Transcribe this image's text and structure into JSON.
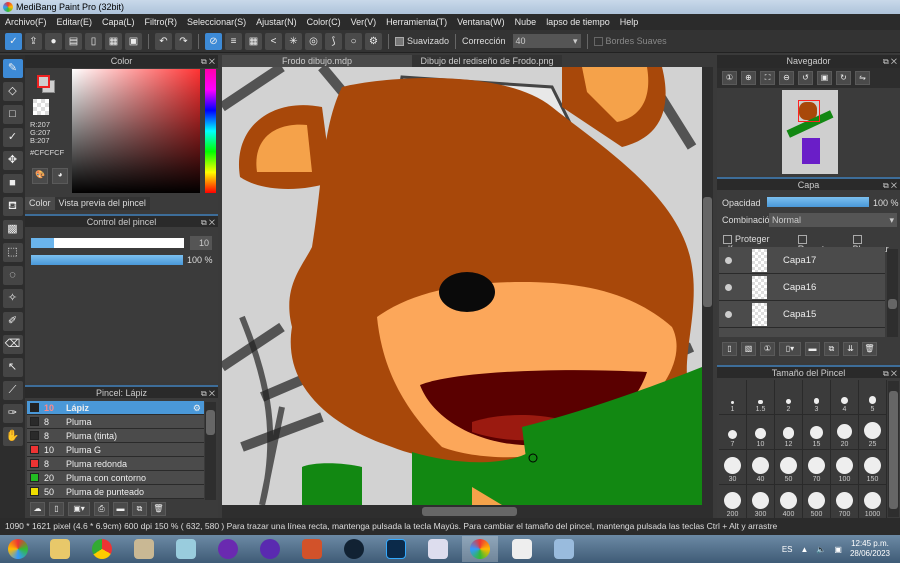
{
  "app": {
    "title": "MediBang Paint Pro (32bit)"
  },
  "menu": [
    "Archivo(F)",
    "Editar(E)",
    "Capa(L)",
    "Filtro(R)",
    "Seleccionar(S)",
    "Ajustar(N)",
    "Color(C)",
    "Ver(V)",
    "Herramienta(T)",
    "Ventana(W)",
    "Nube",
    "lapso de tiempo",
    "Help"
  ],
  "toolbar": {
    "suavizado": "Suavizado",
    "correccion": "Corrección",
    "correccion_value": "40",
    "bordes": "Bordes Suaves"
  },
  "color_panel": {
    "title": "Color",
    "r": "R:207",
    "g": "G:207",
    "b": "B:207",
    "hex": "#CFCFCF",
    "tab_color": "Color",
    "tab_preview": "Vista previa del pincel",
    "fg": "#cfcfcf"
  },
  "brush_control": {
    "title": "Control del pincel",
    "size": "10",
    "opacity": "100 %",
    "size_fraction": 0.15,
    "opacity_fraction": 1.0
  },
  "brush_list": {
    "title": "Pincel: Lápiz",
    "items": [
      {
        "size": "10",
        "name": "Lápiz",
        "color": "#222222"
      },
      {
        "size": "8",
        "name": "Pluma",
        "color": "#2a2a2a"
      },
      {
        "size": "8",
        "name": "Pluma (tinta)",
        "color": "#2a2a2a"
      },
      {
        "size": "10",
        "name": "Pluma G",
        "color": "#ee3333"
      },
      {
        "size": "8",
        "name": "Pluma redonda",
        "color": "#ee3333"
      },
      {
        "size": "20",
        "name": "Pluma con contorno",
        "color": "#22bb22"
      },
      {
        "size": "50",
        "name": "Pluma de punteado",
        "color": "#eedd00"
      }
    ]
  },
  "tabs": [
    "Frodo dibujo.mdp",
    "Dibujo del rediseño de Frodo.png"
  ],
  "navigator": {
    "title": "Navegador"
  },
  "layer_panel": {
    "title": "Capa",
    "opacity_label": "Opacidad",
    "opacity": "100 %",
    "blend_label": "Combinación",
    "blend": "Normal",
    "protect": "Proteger alfa",
    "clip": "Recorte",
    "lock": "Bloquear",
    "layers": [
      "Capa17",
      "Capa16",
      "Capa15"
    ]
  },
  "brush_size": {
    "title": "Tamaño del Pincel",
    "sizes": [
      "1",
      "1.5",
      "2",
      "3",
      "4",
      "5",
      "7",
      "10",
      "12",
      "15",
      "20",
      "25",
      "30",
      "40",
      "50",
      "70",
      "100",
      "150",
      "200",
      "300",
      "400",
      "500",
      "700",
      "1000"
    ]
  },
  "status": "1090 * 1621 pixel   (4.6 * 6.9cm)   600 dpi   150 %   ( 632, 580 )   Para trazar una línea recta, mantenga pulsada la tecla Mayús. Para cambiar el tamaño del pincel, mantenga pulsada las teclas Ctrl + Alt y arrastre",
  "taskbar": {
    "lang": "ES",
    "time": "12:45 p.m.",
    "date": "28/06/2023"
  }
}
